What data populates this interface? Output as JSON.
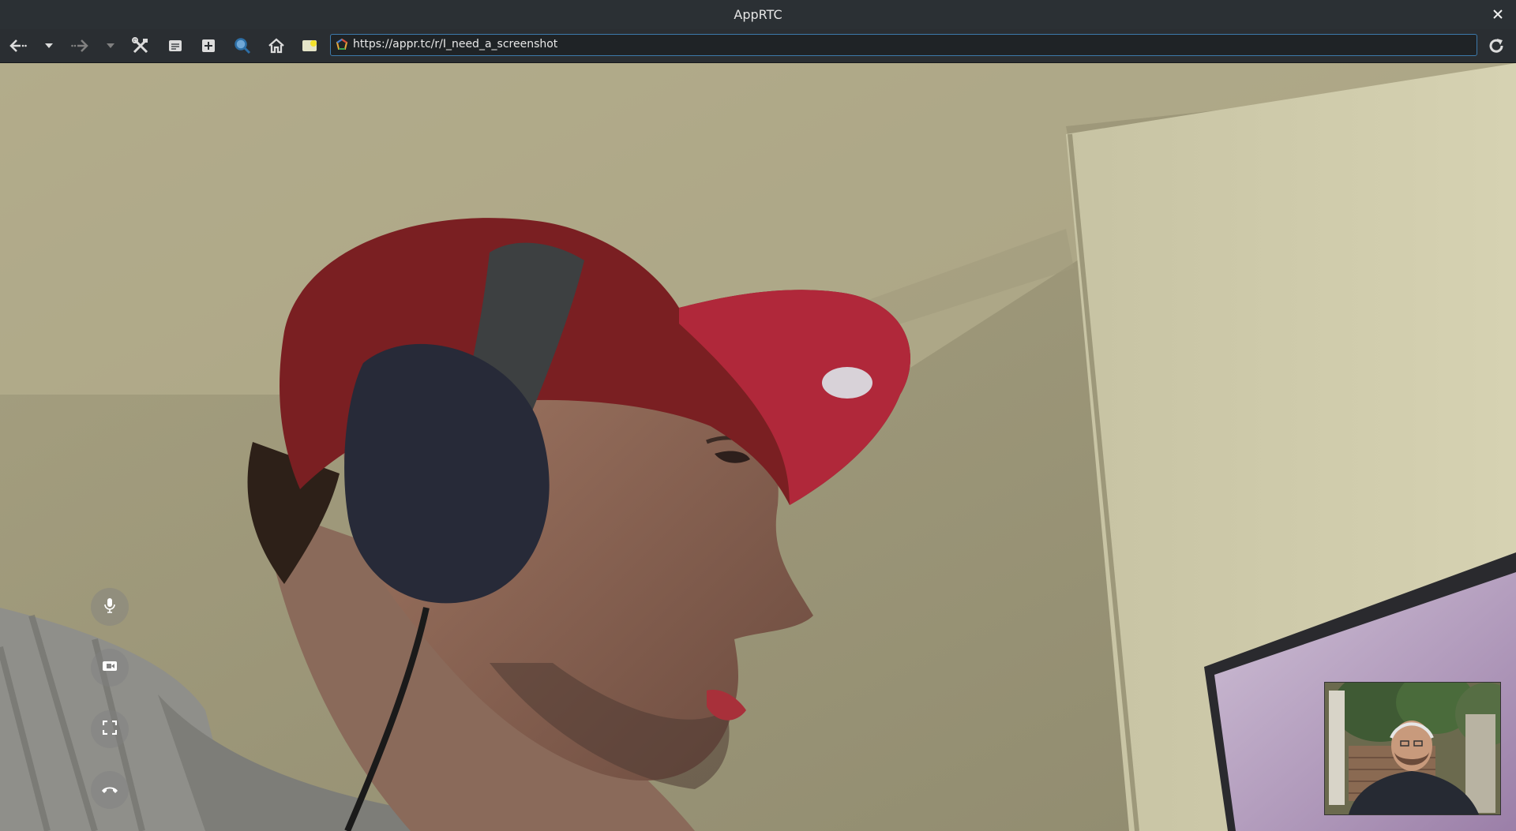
{
  "window": {
    "title": "AppRTC",
    "close_icon": "close-icon"
  },
  "toolbar": {
    "back_icon": "back-arrow-icon",
    "back_history_icon": "chevron-down-icon",
    "forward_icon": "forward-arrow-icon",
    "forward_history_icon": "chevron-down-icon",
    "tools_icon": "tools-icon",
    "reader_icon": "reader-icon",
    "extension_icon": "extension-icon",
    "search_icon": "search-icon",
    "home_icon": "home-icon",
    "bookmark_icon": "bookmark-icon",
    "reload_icon": "reload-icon"
  },
  "address_bar": {
    "url": "https://appr.tc/r/I_need_a_screenshot",
    "site_icon": "site-favicon-icon"
  },
  "call": {
    "controls": [
      {
        "name": "mute-audio-button",
        "icon": "microphone-icon"
      },
      {
        "name": "mute-video-button",
        "icon": "video-camera-icon"
      },
      {
        "name": "fullscreen-button",
        "icon": "fullscreen-icon"
      },
      {
        "name": "hangup-button",
        "icon": "hangup-icon"
      }
    ]
  },
  "colors": {
    "titlebar": "#2b3034",
    "toolbar": "#2a2e32",
    "url_border": "#3d7aab",
    "wall": "#b7b190",
    "cap": "#7a1f22"
  }
}
